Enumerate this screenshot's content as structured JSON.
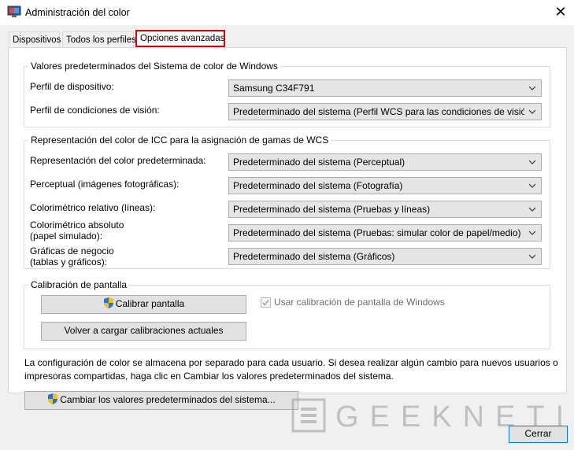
{
  "window": {
    "title": "Administración del color",
    "close_icon": "close-icon"
  },
  "tabs": [
    {
      "label": "Dispositivos"
    },
    {
      "label": "Todos los perfiles"
    },
    {
      "label": "Opciones avanzadas",
      "active": true,
      "highlight": "#e00000"
    }
  ],
  "wcs_defaults": {
    "title": "Valores predeterminados del Sistema de color de Windows",
    "device_profile": {
      "label": "Perfil de dispositivo:",
      "value": "Samsung C34F791"
    },
    "viewing_conditions": {
      "label": "Perfil de condiciones de visión:",
      "value": "Predeterminado del sistema (Perfil WCS para las condiciones de visión"
    }
  },
  "icc_rendering": {
    "title": "Representación del color de ICC para la asignación de gamas de WCS",
    "rows": [
      {
        "label": "Representación del color predeterminada:",
        "value": "Predeterminado del sistema (Perceptual)"
      },
      {
        "label": "Perceptual (imágenes fotográficas):",
        "value": "Predeterminado del sistema (Fotografía)"
      },
      {
        "label": "Colorimétrico relativo (líneas):",
        "value": "Predeterminado del sistema (Pruebas y líneas)"
      },
      {
        "label_line1": "Colorimétrico absoluto",
        "label_line2": "(papel simulado):",
        "value": "Predeterminado del sistema (Pruebas: simular color de papel/medio)"
      },
      {
        "label_line1": "Gráficas de negocio",
        "label_line2": "(tablas y gráficos):",
        "value": "Predeterminado del sistema (Gráficos)"
      }
    ]
  },
  "calibration": {
    "title": "Calibración de pantalla",
    "calibrate_button": "Calibrar pantalla",
    "reload_button": "Volver a cargar calibraciones actuales",
    "use_windows_calibration": {
      "label": "Usar calibración de pantalla de Windows",
      "checked": true,
      "disabled": true
    }
  },
  "note": "La configuración de color se almacena por separado para cada usuario. Si desea realizar algún cambio para nuevos usuarios o impresoras compartidas, haga clic en Cambiar los valores predeterminados del sistema.",
  "change_defaults_button": "Cambiar los valores predeterminados del sistema...",
  "close_button": "Cerrar",
  "watermark": "GEEKNETIC",
  "colors": {
    "tab_highlight": "#e00000",
    "window_bg": "#f0f0f0",
    "panel_bg": "#ffffff",
    "dropdown_bg": "#e5e5e5"
  }
}
